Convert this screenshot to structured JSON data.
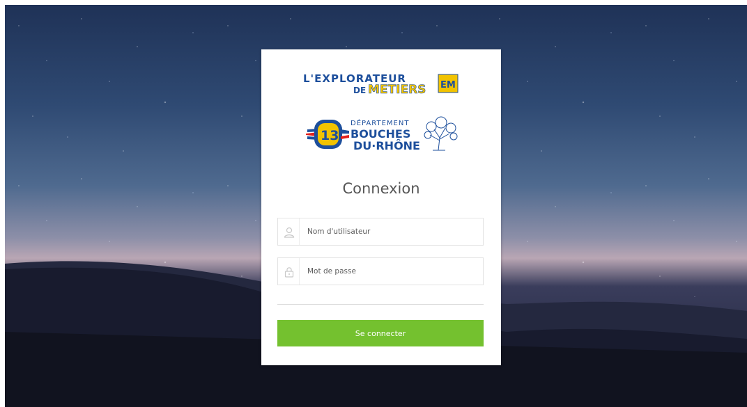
{
  "brand": {
    "app_logo_line1": "L'EXPLORATEUR",
    "app_logo_line2_prefix": "DE",
    "app_logo_line2": "METIERS",
    "app_badge": "EM",
    "dept_label": "DÉPARTEMENT",
    "dept_number": "13",
    "dept_name_line1": "BOUCHES",
    "dept_name_line2": "DU·RHÔNE"
  },
  "login": {
    "title": "Connexion",
    "username_placeholder": "Nom d'utilisateur",
    "password_placeholder": "Mot de passe",
    "submit_label": "Se connecter"
  },
  "colors": {
    "accent_green": "#74c12f",
    "logo_blue": "#1d4f9c",
    "logo_yellow": "#f2c300"
  },
  "icons": {
    "username": "user-icon",
    "password": "lock-icon"
  }
}
